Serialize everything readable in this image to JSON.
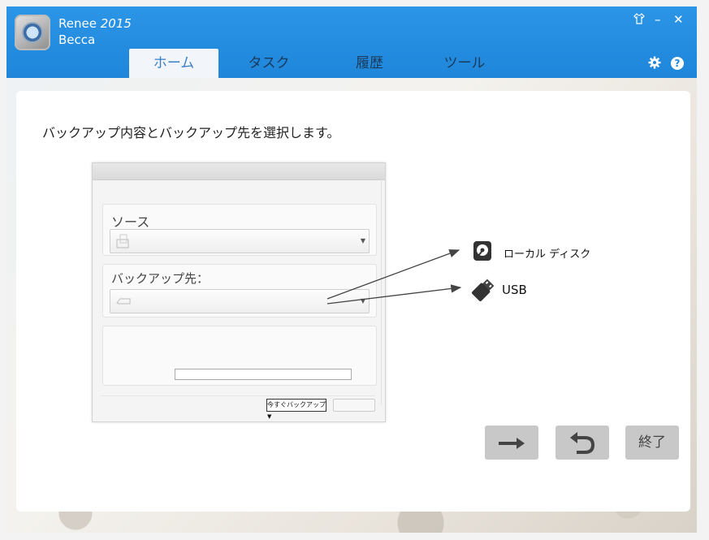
{
  "app": {
    "name": "Renee",
    "year": "2015",
    "subtitle": "Becca"
  },
  "window_controls": {
    "skin_icon": "shirt-icon",
    "minimize_label": "–",
    "close_label": "✕"
  },
  "tabs": [
    {
      "label": "ホーム",
      "active": true
    },
    {
      "label": "タスク",
      "active": false
    },
    {
      "label": "履歴",
      "active": false
    },
    {
      "label": "ツール",
      "active": false
    }
  ],
  "header_icons": {
    "settings_icon": "gear-icon",
    "help_label": "?"
  },
  "main": {
    "instruction": "バックアップ内容とバックアップ先を選択します。",
    "source_label": "ソース",
    "destination_label": "バックアップ先：",
    "mini_select_label": "今すぐバックアップ",
    "destinations": [
      {
        "label": "ローカル ディスク",
        "icon": "hard-disk-icon"
      },
      {
        "label": "USB",
        "icon": "usb-drive-icon"
      }
    ]
  },
  "buttons": {
    "next_icon": "arrow-right-icon",
    "back_icon": "undo-icon",
    "finish_label": "終了"
  },
  "colors": {
    "header_blue": "#1f86da",
    "active_tab_text": "#3a7fc4",
    "button_gray": "#c8c8c8"
  }
}
